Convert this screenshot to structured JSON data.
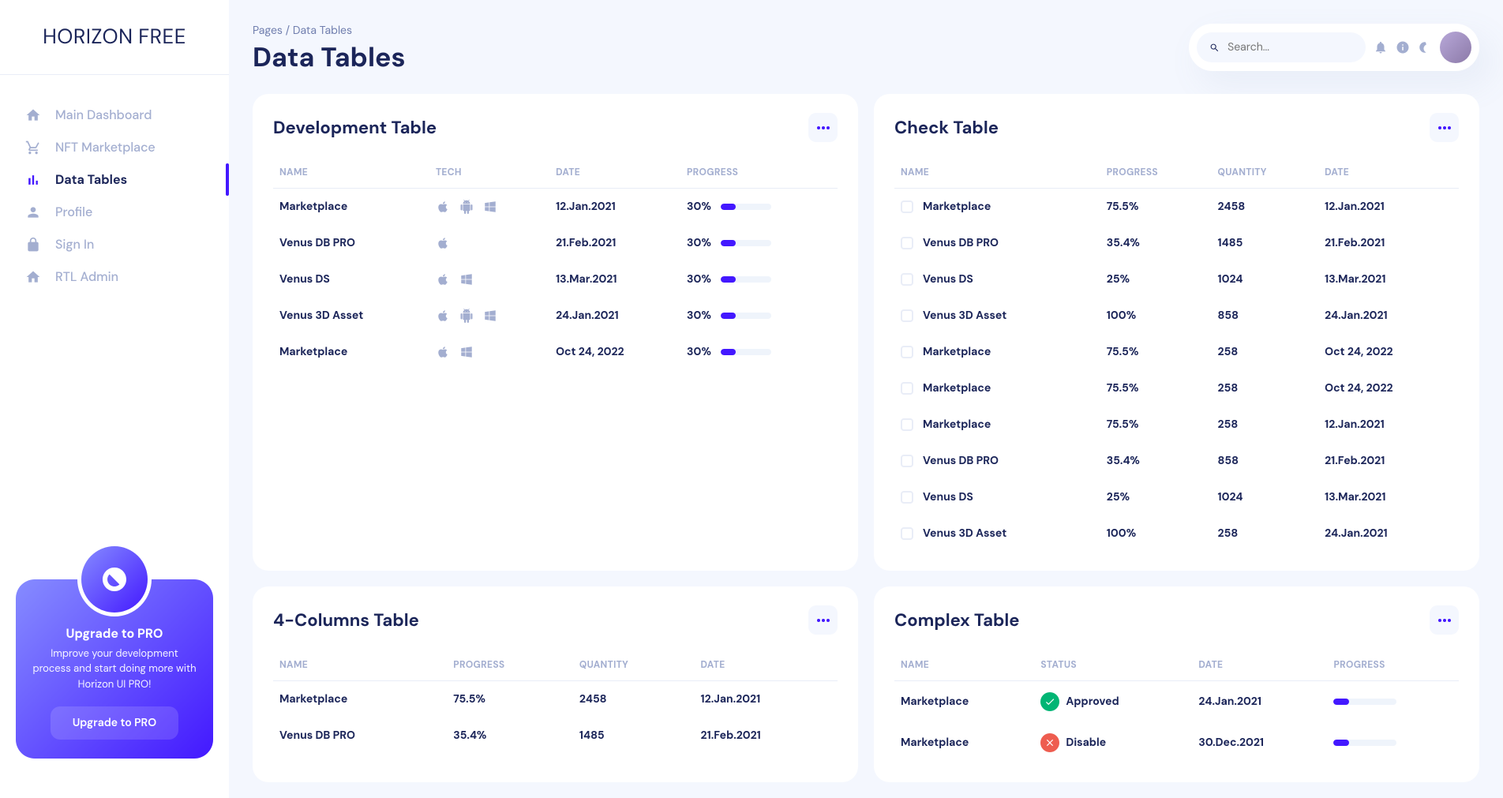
{
  "logo": {
    "main": "HORIZON",
    "sub": "FREE"
  },
  "breadcrumb": "Pages / Data Tables",
  "page_title": "Data Tables",
  "search": {
    "placeholder": "Search..."
  },
  "sidebar": {
    "items": [
      {
        "label": "Main Dashboard",
        "icon": "home"
      },
      {
        "label": "NFT Marketplace",
        "icon": "cart"
      },
      {
        "label": "Data Tables",
        "icon": "chart",
        "active": true
      },
      {
        "label": "Profile",
        "icon": "person"
      },
      {
        "label": "Sign In",
        "icon": "lock"
      },
      {
        "label": "RTL Admin",
        "icon": "home"
      }
    ]
  },
  "upgrade": {
    "title": "Upgrade to PRO",
    "desc": "Improve your development process and start doing more with Horizon UI PRO!",
    "button": "Upgrade to PRO"
  },
  "dev_table": {
    "title": "Development Table",
    "headers": [
      "NAME",
      "TECH",
      "DATE",
      "PROGRESS"
    ],
    "rows": [
      {
        "name": "Marketplace",
        "tech": [
          "apple",
          "android",
          "windows"
        ],
        "date": "12.Jan.2021",
        "progress": "30%",
        "val": 30
      },
      {
        "name": "Venus DB PRO",
        "tech": [
          "apple"
        ],
        "date": "21.Feb.2021",
        "progress": "30%",
        "val": 30
      },
      {
        "name": "Venus DS",
        "tech": [
          "apple",
          "windows"
        ],
        "date": "13.Mar.2021",
        "progress": "30%",
        "val": 30
      },
      {
        "name": "Venus 3D Asset",
        "tech": [
          "apple",
          "android",
          "windows"
        ],
        "date": "24.Jan.2021",
        "progress": "30%",
        "val": 30
      },
      {
        "name": "Marketplace",
        "tech": [
          "apple",
          "windows"
        ],
        "date": "Oct 24, 2022",
        "progress": "30%",
        "val": 30
      }
    ]
  },
  "check_table": {
    "title": "Check Table",
    "headers": [
      "NAME",
      "PROGRESS",
      "QUANTITY",
      "DATE"
    ],
    "rows": [
      {
        "name": "Marketplace",
        "progress": "75.5%",
        "quantity": "2458",
        "date": "12.Jan.2021"
      },
      {
        "name": "Venus DB PRO",
        "progress": "35.4%",
        "quantity": "1485",
        "date": "21.Feb.2021"
      },
      {
        "name": "Venus DS",
        "progress": "25%",
        "quantity": "1024",
        "date": "13.Mar.2021"
      },
      {
        "name": "Venus 3D Asset",
        "progress": "100%",
        "quantity": "858",
        "date": "24.Jan.2021"
      },
      {
        "name": "Marketplace",
        "progress": "75.5%",
        "quantity": "258",
        "date": "Oct 24, 2022"
      },
      {
        "name": "Marketplace",
        "progress": "75.5%",
        "quantity": "258",
        "date": "Oct 24, 2022"
      },
      {
        "name": "Marketplace",
        "progress": "75.5%",
        "quantity": "258",
        "date": "12.Jan.2021"
      },
      {
        "name": "Venus DB PRO",
        "progress": "35.4%",
        "quantity": "858",
        "date": "21.Feb.2021"
      },
      {
        "name": "Venus DS",
        "progress": "25%",
        "quantity": "1024",
        "date": "13.Mar.2021"
      },
      {
        "name": "Venus 3D Asset",
        "progress": "100%",
        "quantity": "258",
        "date": "24.Jan.2021"
      }
    ]
  },
  "four_col_table": {
    "title": "4-Columns Table",
    "headers": [
      "NAME",
      "PROGRESS",
      "QUANTITY",
      "DATE"
    ],
    "rows": [
      {
        "name": "Marketplace",
        "progress": "75.5%",
        "quantity": "2458",
        "date": "12.Jan.2021"
      },
      {
        "name": "Venus DB PRO",
        "progress": "35.4%",
        "quantity": "1485",
        "date": "21.Feb.2021"
      }
    ]
  },
  "complex_table": {
    "title": "Complex Table",
    "headers": [
      "NAME",
      "STATUS",
      "DATE",
      "PROGRESS"
    ],
    "rows": [
      {
        "name": "Marketplace",
        "status": "Approved",
        "status_type": "approved",
        "date": "24.Jan.2021",
        "val": 25
      },
      {
        "name": "Marketplace",
        "status": "Disable",
        "status_type": "disable",
        "date": "30.Dec.2021",
        "val": 25
      }
    ]
  }
}
